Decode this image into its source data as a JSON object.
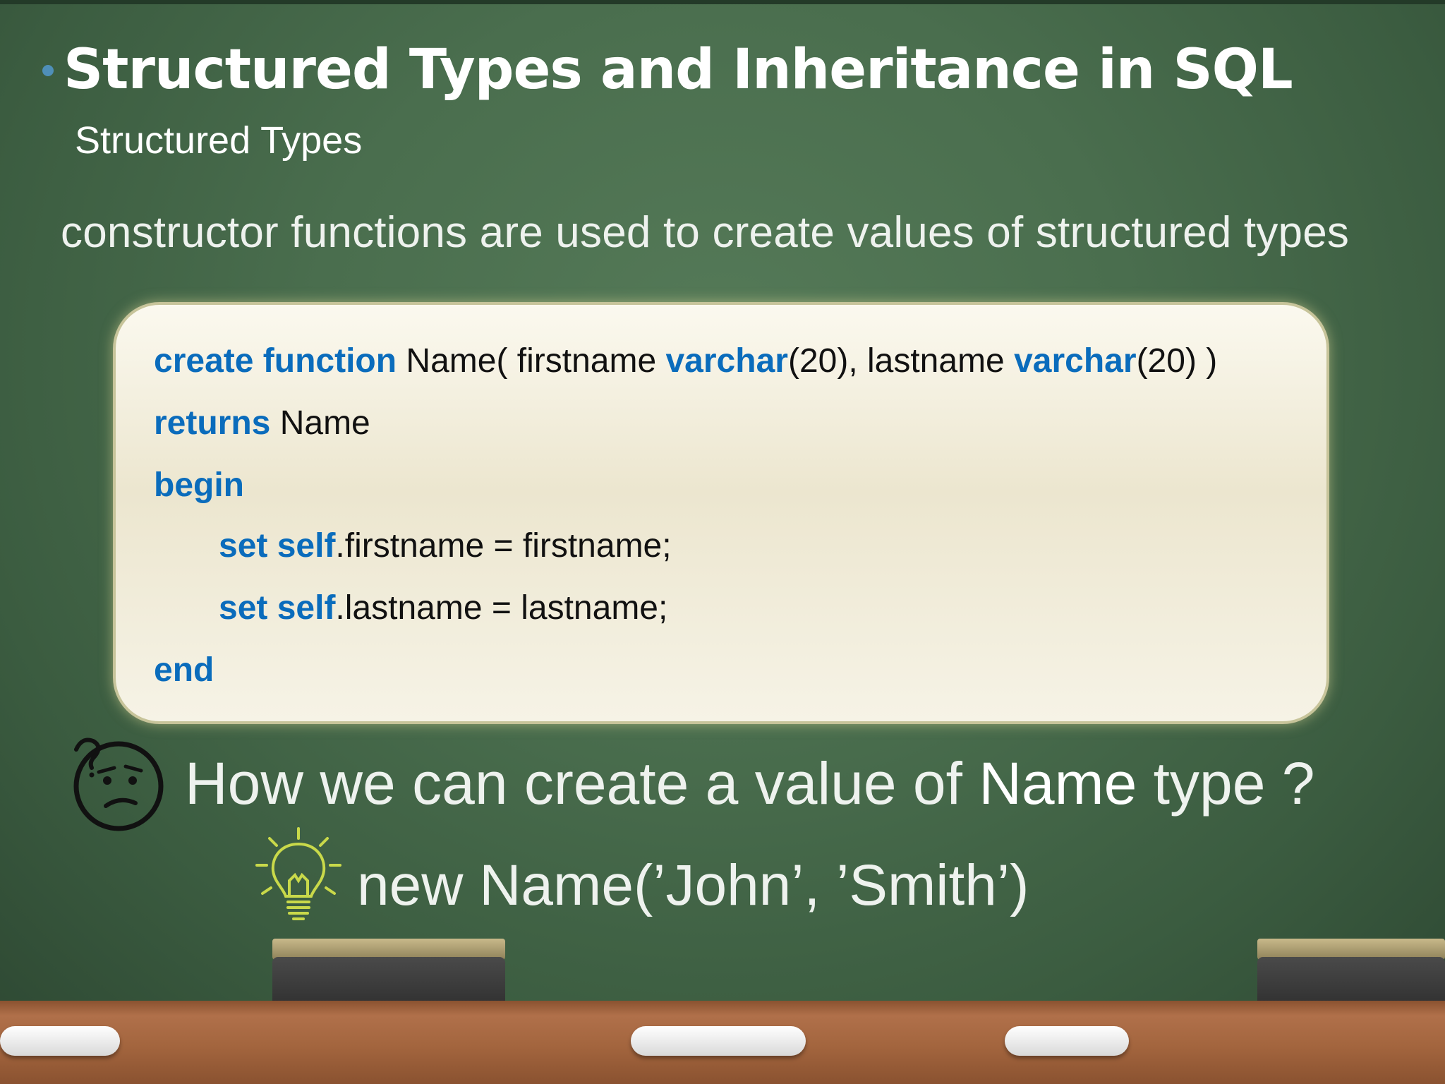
{
  "slide": {
    "title": "Structured Types and Inheritance in SQL",
    "subtitle": "Structured Types",
    "lead": "constructor functions are used to create values of structured types"
  },
  "code": {
    "line1": {
      "kw1": "create function",
      "t1": " Name( firstname ",
      "kw2": "varchar",
      "t2": "(20), lastname ",
      "kw3": "varchar",
      "t3": "(20) )"
    },
    "line2": {
      "kw": "returns",
      "t": " Name"
    },
    "line3": {
      "kw": "begin"
    },
    "line4": {
      "kw": "set self",
      "t": ".firstname = firstname;"
    },
    "line5": {
      "kw": "set self",
      "t": ".lastname = lastname;"
    },
    "line6": {
      "kw": "end"
    }
  },
  "question": {
    "before": "How we can create a value of ",
    "emph": "Name",
    "after": " type ?"
  },
  "answer": {
    "text": "new Name(’John’, ’Smith’)"
  },
  "icons": {
    "question": "confused-face-icon",
    "idea": "lightbulb-icon"
  },
  "colors": {
    "keyword": "#0a6cbc",
    "board": "#4a6e4e",
    "text": "#ffffff"
  }
}
